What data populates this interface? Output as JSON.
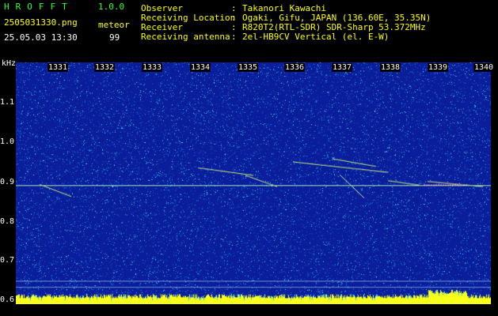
{
  "header": {
    "app_name": "HROFFT",
    "app_version": "1.0.0",
    "filename": "2505031330.png",
    "mode_label": "meteor",
    "datetime": "25.05.03 13:30",
    "count": "99",
    "info": [
      {
        "label": "Observer",
        "value": "Takanori Kawachi"
      },
      {
        "label": "Receiving Location",
        "value": "Ogaki, Gifu, JAPAN (136.60E, 35.35N)"
      },
      {
        "label": "Receiver",
        "value": "R820T2(RTL-SDR) SDR-Sharp 53.372MHz"
      },
      {
        "label": "Receiving antenna",
        "value": "2el-HB9CV Vertical (el. E-W)"
      }
    ]
  },
  "spectrogram": {
    "y_unit": "kHz",
    "y_ticks": [
      "1.1",
      "1.0",
      "0.9",
      "0.8",
      "0.7",
      "0.6"
    ],
    "x_ticks": [
      "1331",
      "1332",
      "1333",
      "1334",
      "1335",
      "1336",
      "1337",
      "1338",
      "1339",
      "1340"
    ],
    "colors": {
      "background": "#0a1e9c",
      "noise": "#17a4d6",
      "signal": "#e9f06a",
      "baseline": "#f7ff1a"
    }
  }
}
